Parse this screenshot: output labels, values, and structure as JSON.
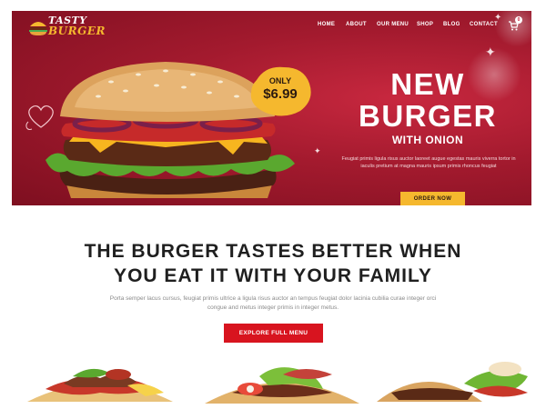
{
  "header": {
    "logo_top": "TASTY",
    "logo_bottom": "BURGER",
    "nav": [
      {
        "label": "HOME"
      },
      {
        "label": "ABOUT"
      },
      {
        "label": "OUR MENU"
      },
      {
        "label": "SHOP"
      },
      {
        "label": "BLOG"
      },
      {
        "label": "CONTACT"
      }
    ],
    "cart_count": "0"
  },
  "hero": {
    "badge_only": "ONLY",
    "badge_price": "$6.99",
    "title_line1": "NEW",
    "title_line2": "BURGER",
    "subtitle": "WITH ONION",
    "description": "Feugiat primis ligula risus auctor laoreet augue egestas mauris viverra tortor in iaculis pretium at magna mauris ipsum primis rhoncus feugiat",
    "cta": "ORDER NOW"
  },
  "intro": {
    "headline_line1": "THE BURGER TASTES BETTER WHEN",
    "headline_line2": "YOU EAT IT WITH YOUR FAMILY",
    "body": "Porta semper lacus cursus, feugiat primis ultrice a ligula risus auctor an tempus feugiat dolor lacinia cubilia curae integer orci congue and metus integer primis in integer metus.",
    "cta": "EXPLORE FULL MENU"
  },
  "colors": {
    "hero_red": "#a31a2e",
    "accent_yellow": "#f5b82e",
    "cta_red": "#d8141f"
  }
}
